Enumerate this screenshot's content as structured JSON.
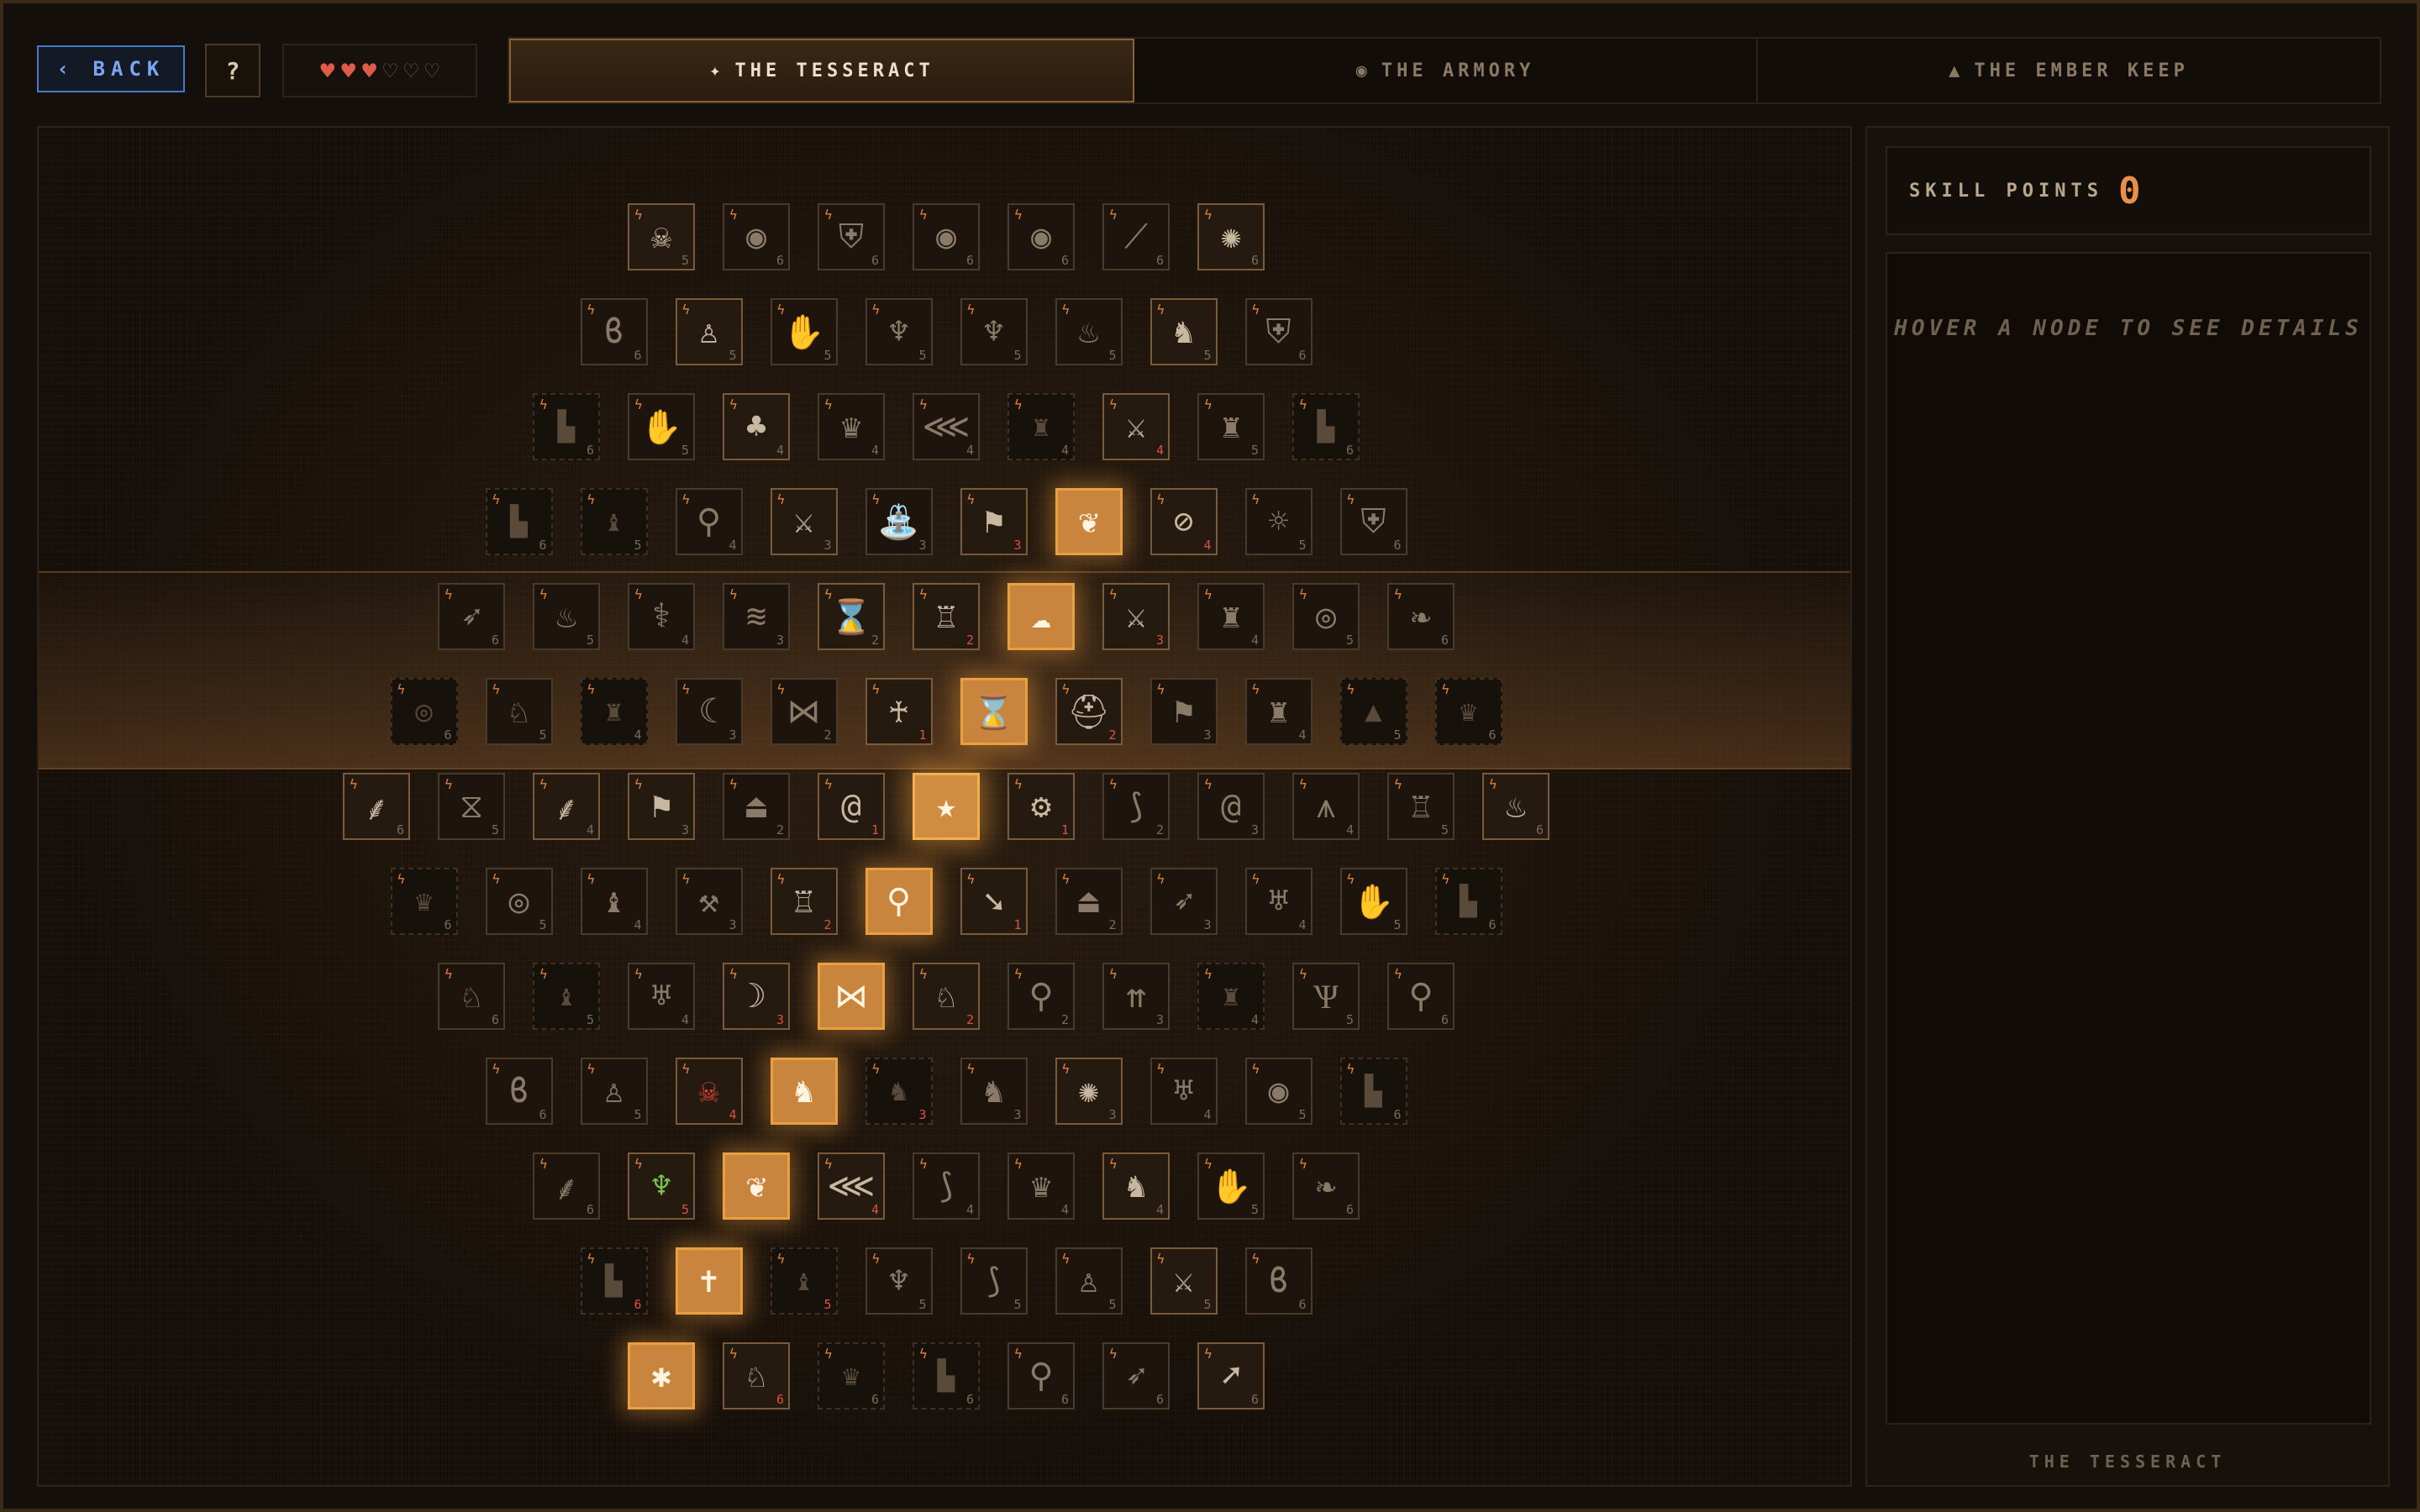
{
  "header": {
    "back_label": "‹ BACK",
    "help_label": "?",
    "hearts": {
      "full": 3,
      "total": 6
    },
    "tabs": [
      {
        "label": "THE TESSERACT",
        "icon": "sparkle-icon",
        "glyph": "✦",
        "active": true
      },
      {
        "label": "THE ARMORY",
        "icon": "shield-icon",
        "glyph": "◉",
        "active": false
      },
      {
        "label": "THE EMBER KEEP",
        "icon": "triangle-icon",
        "glyph": "▲",
        "active": false
      }
    ]
  },
  "colors": {
    "accent": "#e8904a",
    "owned": "#c9843e",
    "back": "#79a6ee"
  },
  "board": {
    "rows": [
      {
        "nodes": [
          {
            "icon": "skull-crossbones-icon",
            "glyph": "☠",
            "cost": "5",
            "state": "avail"
          },
          {
            "icon": "eye-icon",
            "glyph": "◉",
            "cost": "6",
            "state": "normal"
          },
          {
            "icon": "shield-icon",
            "glyph": "⛨",
            "cost": "6",
            "state": "normal"
          },
          {
            "icon": "eye-icon",
            "glyph": "◉",
            "cost": "6",
            "state": "normal"
          },
          {
            "icon": "eye-icon",
            "glyph": "◉",
            "cost": "6",
            "state": "normal"
          },
          {
            "icon": "slash-icon",
            "glyph": "⟋",
            "cost": "6",
            "state": "normal"
          },
          {
            "icon": "burst-icon",
            "glyph": "✺",
            "cost": "6",
            "state": "avail"
          }
        ]
      },
      {
        "nodes": [
          {
            "icon": "swirl-icon",
            "glyph": "ϐ",
            "cost": "6",
            "state": "normal"
          },
          {
            "icon": "figure-icon",
            "glyph": "♙",
            "cost": "5",
            "state": "avail"
          },
          {
            "icon": "hand-icon",
            "glyph": "✋",
            "cost": "5",
            "state": "normal"
          },
          {
            "icon": "winged-skull-icon",
            "glyph": "♆",
            "cost": "5",
            "state": "normal"
          },
          {
            "icon": "winged-skull-icon",
            "glyph": "♆",
            "cost": "5",
            "state": "normal"
          },
          {
            "icon": "flames-icon",
            "glyph": "♨",
            "cost": "5",
            "state": "normal"
          },
          {
            "icon": "knight-icon",
            "glyph": "♞",
            "cost": "5",
            "state": "avail"
          },
          {
            "icon": "shield-icon",
            "glyph": "⛨",
            "cost": "6",
            "state": "normal"
          }
        ]
      },
      {
        "nodes": [
          {
            "icon": "gauntlet-icon",
            "glyph": "▙",
            "cost": "6",
            "state": "locked"
          },
          {
            "icon": "hand-icon",
            "glyph": "✋",
            "cost": "5",
            "state": "normal"
          },
          {
            "icon": "tree-icon",
            "glyph": "♣",
            "cost": "4",
            "state": "avail"
          },
          {
            "icon": "crown-icon",
            "glyph": "♛",
            "cost": "4",
            "state": "normal"
          },
          {
            "icon": "claw-icon",
            "glyph": "⋘",
            "cost": "4",
            "state": "normal"
          },
          {
            "icon": "rook-icon",
            "glyph": "♜",
            "cost": "4",
            "state": "locked"
          },
          {
            "icon": "sword-icon",
            "glyph": "⚔",
            "cost": "4",
            "state": "avail",
            "red": true
          },
          {
            "icon": "dragon-icon",
            "glyph": "♜",
            "cost": "5",
            "state": "normal"
          },
          {
            "icon": "gauntlet-icon",
            "glyph": "▙",
            "cost": "6",
            "state": "locked"
          }
        ]
      },
      {
        "nodes": [
          {
            "icon": "gauntlet-icon",
            "glyph": "▙",
            "cost": "6",
            "state": "locked"
          },
          {
            "icon": "bishop-icon",
            "glyph": "♝",
            "cost": "5",
            "state": "locked"
          },
          {
            "icon": "runner-icon",
            "glyph": "⚲",
            "cost": "4",
            "state": "normal"
          },
          {
            "icon": "sword-icon",
            "glyph": "⚔",
            "cost": "3",
            "state": "avail"
          },
          {
            "icon": "fountain-icon",
            "glyph": "⛲",
            "cost": "3",
            "state": "normal"
          },
          {
            "icon": "banner-icon",
            "glyph": "⚑",
            "cost": "3",
            "state": "avail",
            "red": true
          },
          {
            "icon": "phoenix-icon",
            "glyph": "❦",
            "cost": "",
            "state": "owned"
          },
          {
            "icon": "hidden-eye-icon",
            "glyph": "⊘",
            "cost": "4",
            "state": "avail",
            "red": true
          },
          {
            "icon": "sun-icon",
            "glyph": "☼",
            "cost": "5",
            "state": "normal"
          },
          {
            "icon": "shield-icon",
            "glyph": "⛨",
            "cost": "6",
            "state": "normal"
          }
        ]
      },
      {
        "nodes": [
          {
            "icon": "archer-icon",
            "glyph": "➶",
            "cost": "6",
            "state": "normal"
          },
          {
            "icon": "flames-icon",
            "glyph": "♨",
            "cost": "5",
            "state": "normal"
          },
          {
            "icon": "torch-icon",
            "glyph": "⚕",
            "cost": "4",
            "state": "normal"
          },
          {
            "icon": "wave-icon",
            "glyph": "≋",
            "cost": "3",
            "state": "normal"
          },
          {
            "icon": "hourglass-icon",
            "glyph": "⌛",
            "cost": "2",
            "state": "avail"
          },
          {
            "icon": "knight-shield-icon",
            "glyph": "♖",
            "cost": "2",
            "state": "avail",
            "red": true
          },
          {
            "icon": "cloud-icon",
            "glyph": "☁",
            "cost": "",
            "state": "owned"
          },
          {
            "icon": "crossed-swords-icon",
            "glyph": "⚔",
            "cost": "3",
            "state": "avail",
            "red": true
          },
          {
            "icon": "dragon-icon",
            "glyph": "♜",
            "cost": "4",
            "state": "normal"
          },
          {
            "icon": "eye-of-horus-icon",
            "glyph": "◎",
            "cost": "5",
            "state": "normal"
          },
          {
            "icon": "leaves-icon",
            "glyph": "❧",
            "cost": "6",
            "state": "normal"
          }
        ]
      },
      {
        "nodes": [
          {
            "icon": "eye-of-horus-icon",
            "glyph": "◎",
            "cost": "6",
            "state": "locked"
          },
          {
            "icon": "wolf-icon",
            "glyph": "♘",
            "cost": "5",
            "state": "normal"
          },
          {
            "icon": "rook-icon",
            "glyph": "♜",
            "cost": "4",
            "state": "locked"
          },
          {
            "icon": "scythe-icon",
            "glyph": "☾",
            "cost": "3",
            "state": "normal"
          },
          {
            "icon": "butterfly-icon",
            "glyph": "⋈",
            "cost": "2",
            "state": "normal"
          },
          {
            "icon": "angel-icon",
            "glyph": "♰",
            "cost": "1",
            "state": "avail",
            "red": true
          },
          {
            "icon": "hourglass-icon",
            "glyph": "⌛",
            "cost": "",
            "state": "owned"
          },
          {
            "icon": "helm-icon",
            "glyph": "⛑",
            "cost": "2",
            "state": "avail",
            "red": true
          },
          {
            "icon": "army-icon",
            "glyph": "⚑",
            "cost": "3",
            "state": "normal"
          },
          {
            "icon": "dragon-icon",
            "glyph": "♜",
            "cost": "4",
            "state": "normal"
          },
          {
            "icon": "pyramid-icon",
            "glyph": "▲",
            "cost": "5",
            "state": "locked"
          },
          {
            "icon": "crown-icon",
            "glyph": "♛",
            "cost": "6",
            "state": "locked"
          }
        ]
      },
      {
        "nodes": [
          {
            "icon": "wing-icon",
            "glyph": "⸙",
            "cost": "6",
            "state": "avail"
          },
          {
            "icon": "dna-icon",
            "glyph": "⧖",
            "cost": "5",
            "state": "normal"
          },
          {
            "icon": "feather-icon",
            "glyph": "⸙",
            "cost": "4",
            "state": "avail"
          },
          {
            "icon": "army-icon",
            "glyph": "⚑",
            "cost": "3",
            "state": "avail"
          },
          {
            "icon": "ufo-icon",
            "glyph": "⏏",
            "cost": "2",
            "state": "normal"
          },
          {
            "icon": "spiral-icon",
            "glyph": "@",
            "cost": "1",
            "state": "avail",
            "red": true
          },
          {
            "icon": "star-icon",
            "glyph": "★",
            "cost": "",
            "state": "center"
          },
          {
            "icon": "gear-icon",
            "glyph": "⚙",
            "cost": "1",
            "state": "avail",
            "red": true
          },
          {
            "icon": "horn-icon",
            "glyph": "⟆",
            "cost": "2",
            "state": "normal"
          },
          {
            "icon": "spiral-shell-icon",
            "glyph": "@",
            "cost": "3",
            "state": "normal"
          },
          {
            "icon": "masonic-icon",
            "glyph": "⩚",
            "cost": "4",
            "state": "normal"
          },
          {
            "icon": "castle-icon",
            "glyph": "♖",
            "cost": "5",
            "state": "normal"
          },
          {
            "icon": "fire-demon-icon",
            "glyph": "♨",
            "cost": "6",
            "state": "avail"
          }
        ]
      },
      {
        "nodes": [
          {
            "icon": "crown-icon",
            "glyph": "♛",
            "cost": "6",
            "state": "locked"
          },
          {
            "icon": "eye-of-horus-icon",
            "glyph": "◎",
            "cost": "5",
            "state": "normal"
          },
          {
            "icon": "bishop-icon",
            "glyph": "♝",
            "cost": "4",
            "state": "normal"
          },
          {
            "icon": "mace-icon",
            "glyph": "⚒",
            "cost": "3",
            "state": "normal"
          },
          {
            "icon": "tower-icon",
            "glyph": "♖",
            "cost": "2",
            "state": "avail",
            "red": true
          },
          {
            "icon": "magnifier-icon",
            "glyph": "⚲",
            "cost": "",
            "state": "owned"
          },
          {
            "icon": "arrow-icon",
            "glyph": "➘",
            "cost": "1",
            "state": "avail",
            "red": true
          },
          {
            "icon": "ufo-icon",
            "glyph": "⏏",
            "cost": "2",
            "state": "normal"
          },
          {
            "icon": "archer-icon",
            "glyph": "➶",
            "cost": "3",
            "state": "normal"
          },
          {
            "icon": "demon-icon",
            "glyph": "♅",
            "cost": "4",
            "state": "normal"
          },
          {
            "icon": "hand-icon",
            "glyph": "✋",
            "cost": "5",
            "state": "normal"
          },
          {
            "icon": "gauntlet-icon",
            "glyph": "▙",
            "cost": "6",
            "state": "locked"
          }
        ]
      },
      {
        "nodes": [
          {
            "icon": "wolf-icon",
            "glyph": "♘",
            "cost": "6",
            "state": "normal"
          },
          {
            "icon": "bishop-icon",
            "glyph": "♝",
            "cost": "5",
            "state": "locked"
          },
          {
            "icon": "demon-icon",
            "glyph": "♅",
            "cost": "4",
            "state": "normal"
          },
          {
            "icon": "bow-icon",
            "glyph": "☽",
            "cost": "3",
            "state": "avail",
            "red": true
          },
          {
            "icon": "butterfly-icon",
            "glyph": "⋈",
            "cost": "",
            "state": "owned"
          },
          {
            "icon": "stag-icon",
            "glyph": "♘",
            "cost": "2",
            "state": "avail",
            "red": true
          },
          {
            "icon": "fighter-icon",
            "glyph": "⚲",
            "cost": "2",
            "state": "normal"
          },
          {
            "icon": "arrows-icon",
            "glyph": "⇈",
            "cost": "3",
            "state": "normal"
          },
          {
            "icon": "rook-icon",
            "glyph": "♜",
            "cost": "4",
            "state": "locked"
          },
          {
            "icon": "antlers-icon",
            "glyph": "Ѱ",
            "cost": "5",
            "state": "normal"
          },
          {
            "icon": "mage-icon",
            "glyph": "⚲",
            "cost": "6",
            "state": "normal"
          }
        ]
      },
      {
        "nodes": [
          {
            "icon": "swirl-icon",
            "glyph": "ϐ",
            "cost": "6",
            "state": "normal"
          },
          {
            "icon": "wizard-icon",
            "glyph": "♙",
            "cost": "5",
            "state": "normal"
          },
          {
            "icon": "skull-icon",
            "glyph": "☠",
            "cost": "4",
            "state": "avail",
            "skull": true,
            "red": true
          },
          {
            "icon": "pegasus-icon",
            "glyph": "♞",
            "cost": "",
            "state": "owned"
          },
          {
            "icon": "horse-icon",
            "glyph": "♞",
            "cost": "3",
            "state": "locked",
            "red": true
          },
          {
            "icon": "horse-icon",
            "glyph": "♞",
            "cost": "3",
            "state": "normal"
          },
          {
            "icon": "kraken-icon",
            "glyph": "✺",
            "cost": "3",
            "state": "avail"
          },
          {
            "icon": "demon-icon",
            "glyph": "♅",
            "cost": "4",
            "state": "normal"
          },
          {
            "icon": "eye-icon",
            "glyph": "◉",
            "cost": "5",
            "state": "normal"
          },
          {
            "icon": "gauntlet-icon",
            "glyph": "▙",
            "cost": "6",
            "state": "locked"
          }
        ]
      },
      {
        "nodes": [
          {
            "icon": "feather-icon",
            "glyph": "⸙",
            "cost": "6",
            "state": "normal"
          },
          {
            "icon": "goblin-icon",
            "glyph": "♆",
            "cost": "5",
            "state": "avail",
            "green": true,
            "red": true
          },
          {
            "icon": "winged-helm-icon",
            "glyph": "❦",
            "cost": "",
            "state": "owned"
          },
          {
            "icon": "claw-icon",
            "glyph": "⋘",
            "cost": "4",
            "state": "avail",
            "red": true
          },
          {
            "icon": "horn-icon",
            "glyph": "⟆",
            "cost": "4",
            "state": "normal"
          },
          {
            "icon": "crown-icon",
            "glyph": "♛",
            "cost": "4",
            "state": "normal"
          },
          {
            "icon": "knight-icon",
            "glyph": "♞",
            "cost": "4",
            "state": "avail"
          },
          {
            "icon": "hand-icon",
            "glyph": "✋",
            "cost": "5",
            "state": "normal"
          },
          {
            "icon": "leaves-icon",
            "glyph": "❧",
            "cost": "6",
            "state": "normal"
          }
        ]
      },
      {
        "nodes": [
          {
            "icon": "gauntlet-icon",
            "glyph": "▙",
            "cost": "6",
            "state": "locked",
            "red": true
          },
          {
            "icon": "saint-icon",
            "glyph": "✝",
            "cost": "",
            "state": "owned"
          },
          {
            "icon": "bishop-icon",
            "glyph": "♝",
            "cost": "5",
            "state": "locked",
            "red": true
          },
          {
            "icon": "winged-skull-icon",
            "glyph": "♆",
            "cost": "5",
            "state": "normal"
          },
          {
            "icon": "horn-icon",
            "glyph": "⟆",
            "cost": "5",
            "state": "normal"
          },
          {
            "icon": "wizard-icon",
            "glyph": "♙",
            "cost": "5",
            "state": "normal"
          },
          {
            "icon": "dagger-icon",
            "glyph": "⚔",
            "cost": "5",
            "state": "avail"
          },
          {
            "icon": "swirl-icon",
            "glyph": "ϐ",
            "cost": "6",
            "state": "normal"
          }
        ]
      },
      {
        "nodes": [
          {
            "icon": "spider-icon",
            "glyph": "✱",
            "cost": "",
            "state": "owned"
          },
          {
            "icon": "wolf-icon",
            "glyph": "♘",
            "cost": "6",
            "state": "avail",
            "red": true
          },
          {
            "icon": "crown-icon",
            "glyph": "♛",
            "cost": "6",
            "state": "locked"
          },
          {
            "icon": "gauntlet-icon",
            "glyph": "▙",
            "cost": "6",
            "state": "locked"
          },
          {
            "icon": "mage-icon",
            "glyph": "⚲",
            "cost": "6",
            "state": "normal"
          },
          {
            "icon": "archer-icon",
            "glyph": "➶",
            "cost": "6",
            "state": "normal"
          },
          {
            "icon": "arrow-icon",
            "glyph": "➚",
            "cost": "6",
            "state": "avail"
          }
        ]
      }
    ]
  },
  "panel": {
    "skill_points_label": "SKILL POINTS",
    "skill_points_value": "0",
    "hint": "HOVER A NODE TO SEE DETAILS",
    "footer": "THE TESSERACT"
  }
}
